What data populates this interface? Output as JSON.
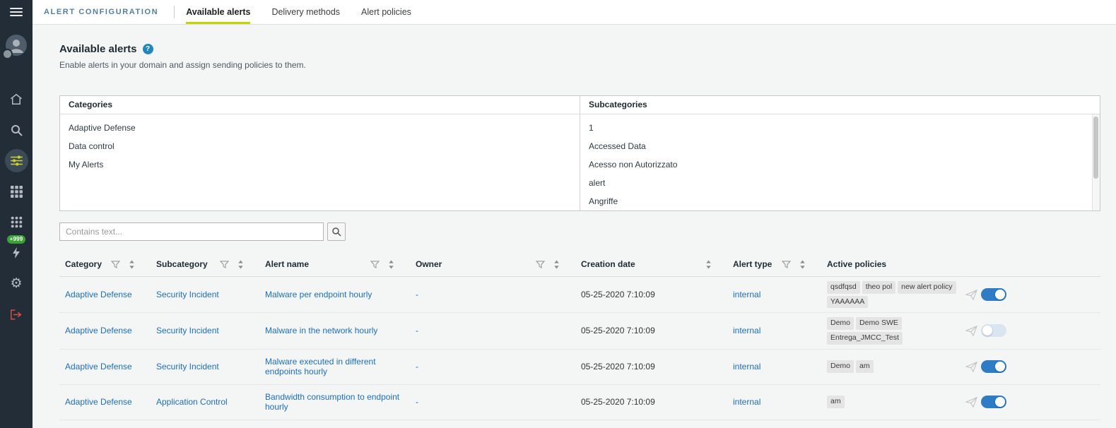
{
  "sidebar": {
    "badge": "+999"
  },
  "header": {
    "title": "ALERT CONFIGURATION",
    "tabs": [
      {
        "label": "Available alerts",
        "active": true
      },
      {
        "label": "Delivery methods",
        "active": false
      },
      {
        "label": "Alert policies",
        "active": false
      }
    ]
  },
  "page": {
    "title": "Available alerts",
    "subtitle": "Enable alerts in your domain and assign sending policies to them."
  },
  "categories_panel": {
    "title": "Categories",
    "items": [
      "Adaptive Defense",
      "Data control",
      "My Alerts"
    ]
  },
  "subcategories_panel": {
    "title": "Subcategories",
    "items": [
      "1",
      "Accessed Data",
      "Acesso non Autorizzato",
      "alert",
      "Angriffe"
    ]
  },
  "search": {
    "placeholder": "Contains text..."
  },
  "table": {
    "columns": [
      {
        "label": "Category",
        "filter": true,
        "sort": true
      },
      {
        "label": "Subcategory",
        "filter": true,
        "sort": true
      },
      {
        "label": "Alert name",
        "filter": true,
        "sort": true
      },
      {
        "label": "Owner",
        "filter": true,
        "sort": true
      },
      {
        "label": "Creation date",
        "filter": false,
        "sort": true
      },
      {
        "label": "Alert type",
        "filter": true,
        "sort": true
      },
      {
        "label": "Active policies",
        "filter": false,
        "sort": false
      }
    ],
    "rows": [
      {
        "category": "Adaptive Defense",
        "subcategory": "Security Incident",
        "alert_name": "Malware per endpoint hourly",
        "owner": "-",
        "creation_date": "05-25-2020 7:10:09",
        "alert_type": "internal",
        "policies": [
          "qsdfqsd",
          "theo pol",
          "new alert policy",
          "YAAAAAA"
        ],
        "enabled": true
      },
      {
        "category": "Adaptive Defense",
        "subcategory": "Security Incident",
        "alert_name": "Malware in the network hourly",
        "owner": "-",
        "creation_date": "05-25-2020 7:10:09",
        "alert_type": "internal",
        "policies": [
          "Demo",
          "Demo SWE",
          "Entrega_JMCC_Test"
        ],
        "enabled": false
      },
      {
        "category": "Adaptive Defense",
        "subcategory": "Security Incident",
        "alert_name": "Malware executed in different endpoints hourly",
        "owner": "-",
        "creation_date": "05-25-2020 7:10:09",
        "alert_type": "internal",
        "policies": [
          "Demo",
          "am"
        ],
        "enabled": true
      },
      {
        "category": "Adaptive Defense",
        "subcategory": "Application Control",
        "alert_name": "Bandwidth consumption to endpoint hourly",
        "owner": "-",
        "creation_date": "05-25-2020 7:10:09",
        "alert_type": "internal",
        "policies": [
          "am"
        ],
        "enabled": true
      }
    ]
  },
  "icons": {
    "menu": "hamburger",
    "avatar": "person",
    "home": "house",
    "search": "magnifier",
    "alert_configuration": "sliders",
    "apps": "grid-squares",
    "modules": "grid-dots",
    "notifications": "lightning",
    "settings": "gear",
    "logout": "exit-door",
    "help": "question-mark-circle",
    "filter": "funnel",
    "sort": "up-down-arrows",
    "send": "paper-plane"
  },
  "colors": {
    "sidebar_bg": "#222d38",
    "accent_blue": "#1d6fb8",
    "tab_underline": "#c3d600",
    "toggle_on": "#2e7cc4",
    "badge_green": "#3aa335",
    "section_title": "#54809d"
  }
}
